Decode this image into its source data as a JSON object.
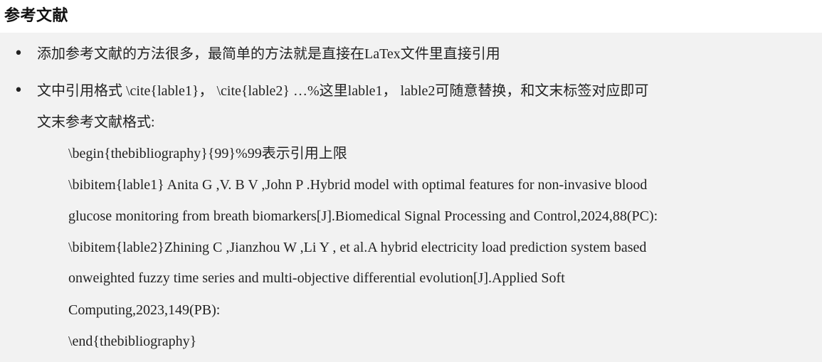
{
  "title": "参考文献",
  "bullets": [
    {
      "text": "添加参考文献的方法很多，最简单的方法就是直接在LaTex文件里直接引用"
    },
    {
      "text": "文中引用格式 \\cite{lable1}， \\cite{lable2} …%这里lable1， lable2可随意替换，和文末标签对应即可"
    }
  ],
  "continuation": "文末参考文献格式:",
  "code_lines": [
    "\\begin{thebibliography}{99}%99表示引用上限",
    "\\bibitem{lable1} Anita G ,V. B V ,John P .Hybrid model with optimal features for non-invasive blood",
    "glucose monitoring from breath biomarkers[J].Biomedical Signal Processing and Control,2024,88(PC):",
    "\\bibitem{lable2}Zhining C ,Jianzhou W ,Li Y , et al.A hybrid electricity load prediction system based",
    "onweighted fuzzy time series and multi-objective differential evolution[J].Applied Soft",
    "Computing,2023,149(PB):",
    "\\end{thebibliography}"
  ]
}
